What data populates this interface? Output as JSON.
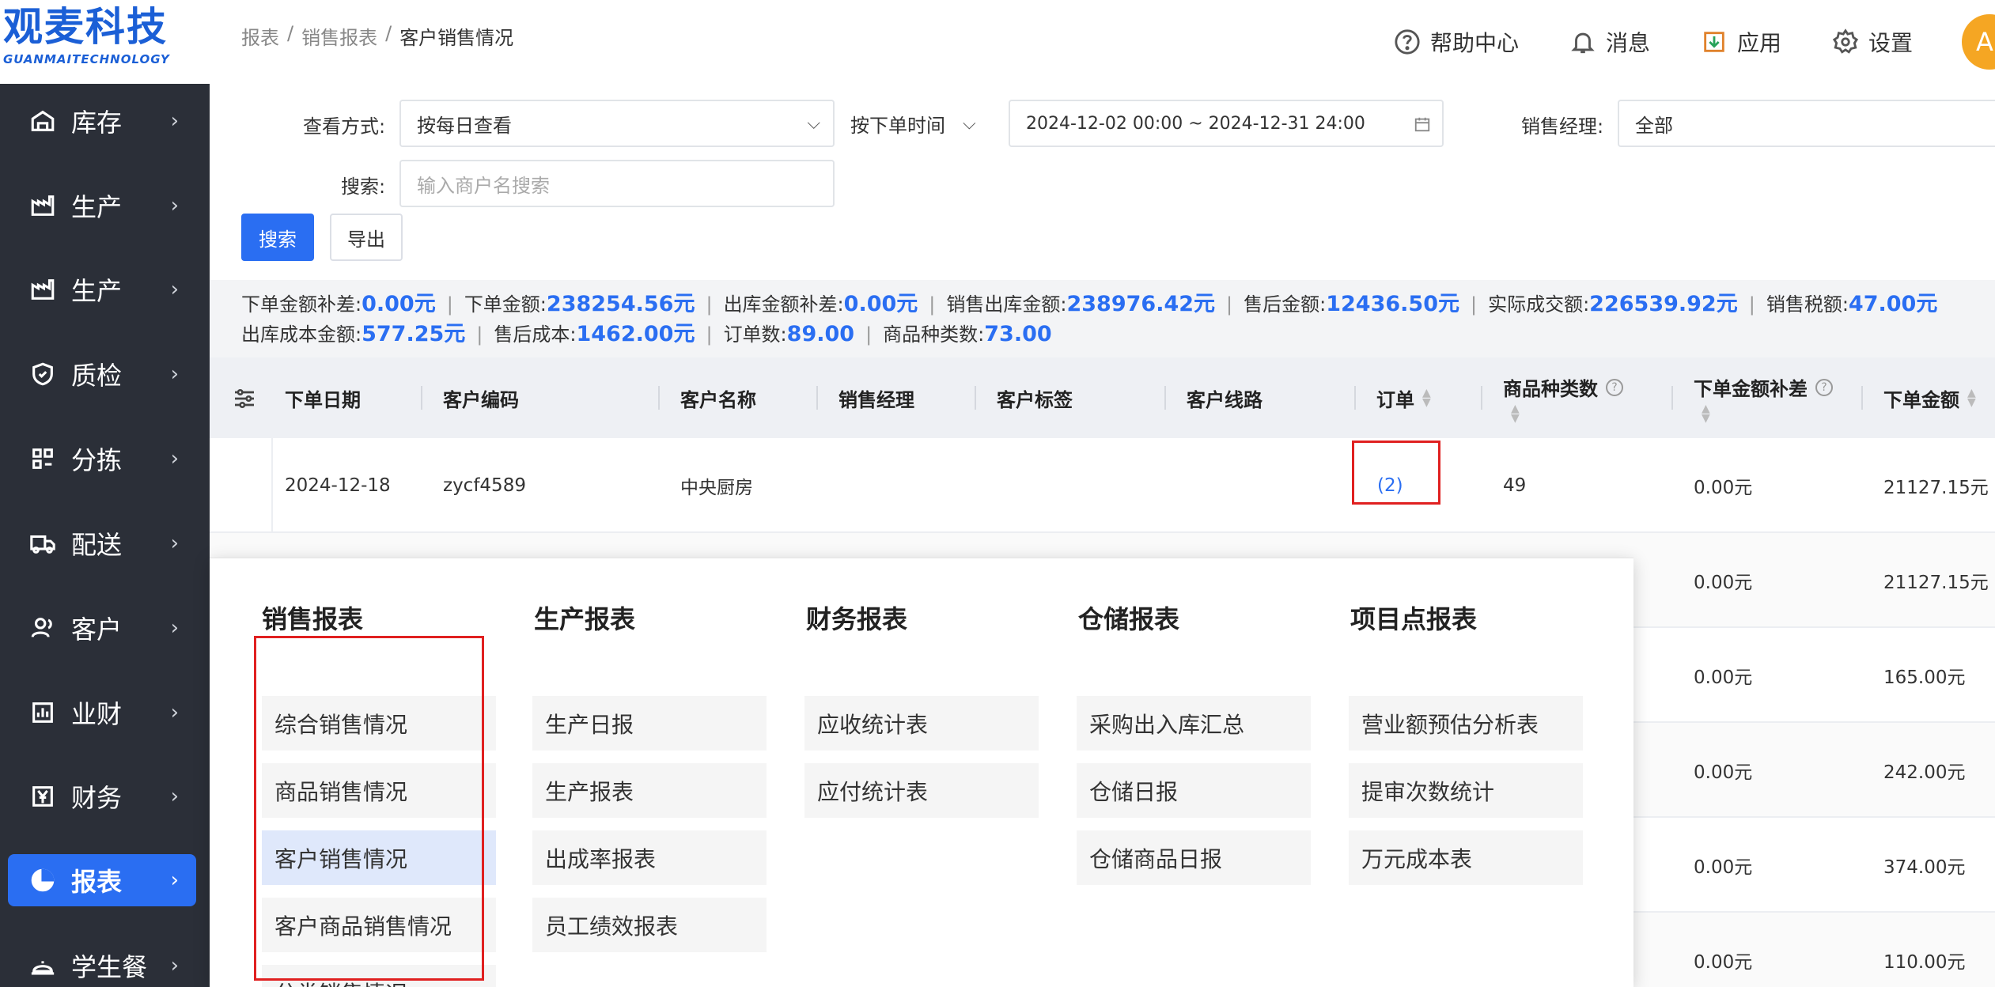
{
  "logo": {
    "cn": "观麦科技",
    "en": "GUANMAITECHNOLOGY"
  },
  "sidebar": {
    "items": [
      {
        "label": "库存",
        "icon": "warehouse-icon"
      },
      {
        "label": "生产",
        "icon": "factory-icon"
      },
      {
        "label": "生产",
        "icon": "factory-icon"
      },
      {
        "label": "质检",
        "icon": "shield-check-icon"
      },
      {
        "label": "分拣",
        "icon": "sorting-icon"
      },
      {
        "label": "配送",
        "icon": "truck-icon"
      },
      {
        "label": "客户",
        "icon": "user-icon"
      },
      {
        "label": "业财",
        "icon": "bar-chart-icon"
      },
      {
        "label": "财务",
        "icon": "yen-icon"
      },
      {
        "label": "报表",
        "icon": "pie-chart-icon",
        "active": true
      },
      {
        "label": "学生餐",
        "icon": "bell-dish-icon"
      }
    ]
  },
  "breadcrumb": {
    "b1": "报表",
    "sep": "/",
    "b2": "销售报表",
    "b3": "客户销售情况"
  },
  "header": {
    "help": "帮助中心",
    "messages": "消息",
    "apps": "应用",
    "settings": "设置",
    "avatar": "A"
  },
  "filters": {
    "view_label": "查看方式:",
    "view_value": "按每日查看",
    "time_type": "按下单时间",
    "date_range": "2024-12-02 00:00 ~ 2024-12-31 24:00",
    "manager_label": "销售经理:",
    "manager_value": "全部",
    "search_label": "搜索:",
    "search_placeholder": "输入商户名搜索",
    "search_btn": "搜索",
    "export_btn": "导出"
  },
  "summary": {
    "row1": [
      {
        "k": "下单金额补差:",
        "v": "0.00元"
      },
      {
        "k": "下单金额:",
        "v": "238254.56元"
      },
      {
        "k": "出库金额补差:",
        "v": "0.00元"
      },
      {
        "k": "销售出库金额:",
        "v": "238976.42元"
      },
      {
        "k": "售后金额:",
        "v": "12436.50元"
      },
      {
        "k": "实际成交额:",
        "v": "226539.92元"
      },
      {
        "k": "销售税额:",
        "v": "47.00元"
      }
    ],
    "row2": [
      {
        "k": "出库成本金额:",
        "v": "577.25元"
      },
      {
        "k": "售后成本:",
        "v": "1462.00元"
      },
      {
        "k": "订单数:",
        "v": "89.00"
      },
      {
        "k": "商品种类数:",
        "v": "73.00"
      }
    ]
  },
  "table": {
    "columns": [
      "下单日期",
      "客户编码",
      "客户名称",
      "销售经理",
      "客户标签",
      "客户线路",
      "订单",
      "商品种类数",
      "下单金额补差",
      "下单金额"
    ],
    "rows": [
      {
        "date": "2024-12-18",
        "code": "zycf4589",
        "name": "中央厨房",
        "order": "(2)",
        "types": "49",
        "diff": "0.00元",
        "amount": "21127.15元"
      },
      {
        "diff": "0.00元",
        "amount": "21127.15元"
      },
      {
        "diff": "0.00元",
        "amount": "165.00元"
      },
      {
        "diff": "0.00元",
        "amount": "242.00元"
      },
      {
        "diff": "0.00元",
        "amount": "374.00元"
      },
      {
        "diff": "0.00元",
        "amount": "110.00元"
      }
    ]
  },
  "report_menu": {
    "groups": [
      {
        "title": "销售报表",
        "items": [
          "综合销售情况",
          "商品销售情况",
          "客户销售情况",
          "客户商品销售情况",
          "分类销售情况"
        ]
      },
      {
        "title": "生产报表",
        "items": [
          "生产日报",
          "生产报表",
          "出成率报表",
          "员工绩效报表"
        ]
      },
      {
        "title": "财务报表",
        "items": [
          "应收统计表",
          "应付统计表"
        ]
      },
      {
        "title": "仓储报表",
        "items": [
          "采购出入库汇总",
          "仓储日报",
          "仓储商品日报"
        ]
      },
      {
        "title": "项目点报表",
        "items": [
          "营业额预估分析表",
          "提审次数统计",
          "万元成本表"
        ]
      }
    ],
    "selected": "客户销售情况"
  },
  "colors": {
    "primary": "#2a6ef2",
    "sidebar_bg": "#2b2f38",
    "highlight_red": "#e02020"
  }
}
